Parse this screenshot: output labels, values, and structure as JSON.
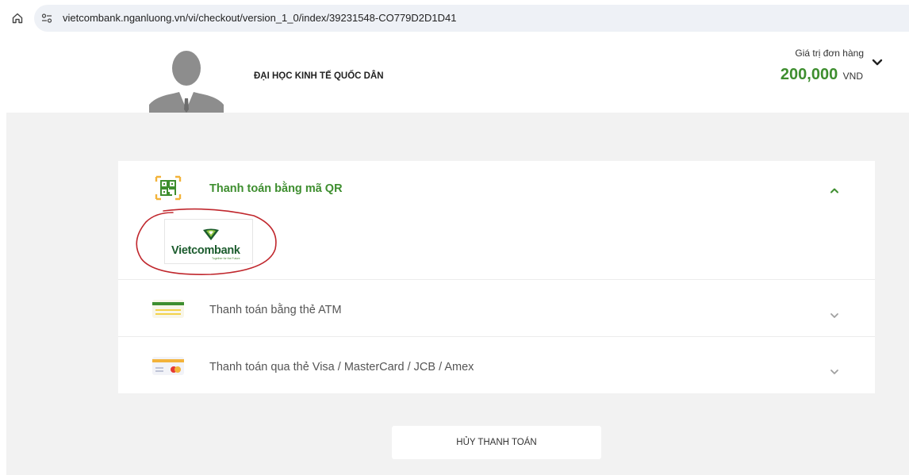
{
  "browser": {
    "url": "vietcombank.nganluong.vn/vi/checkout/version_1_0/index/39231548-CO779D2D1D41"
  },
  "merchant": {
    "name": "ĐẠI HỌC KINH TẾ QUỐC DÂN"
  },
  "order": {
    "value_label": "Giá trị đơn hàng",
    "amount": "200,000",
    "currency": "VND"
  },
  "payment_methods": [
    {
      "label": "Thanh toán bằng mã QR",
      "icon": "qr-code-icon",
      "expanded": true
    },
    {
      "label": "Thanh toán bằng thẻ ATM",
      "icon": "atm-card-icon",
      "expanded": false
    },
    {
      "label": "Thanh toán qua thẻ Visa / MasterCard / JCB / Amex",
      "icon": "credit-card-icon",
      "expanded": false
    }
  ],
  "qr_banks": [
    {
      "name": "Vietcombank",
      "tagline": "Together for the Future"
    }
  ],
  "actions": {
    "cancel_label": "HỦY THANH TOÁN"
  },
  "colors": {
    "accent_green": "#3e8e2f",
    "background": "#f2f2f2",
    "annotation_red": "#c0272d"
  }
}
